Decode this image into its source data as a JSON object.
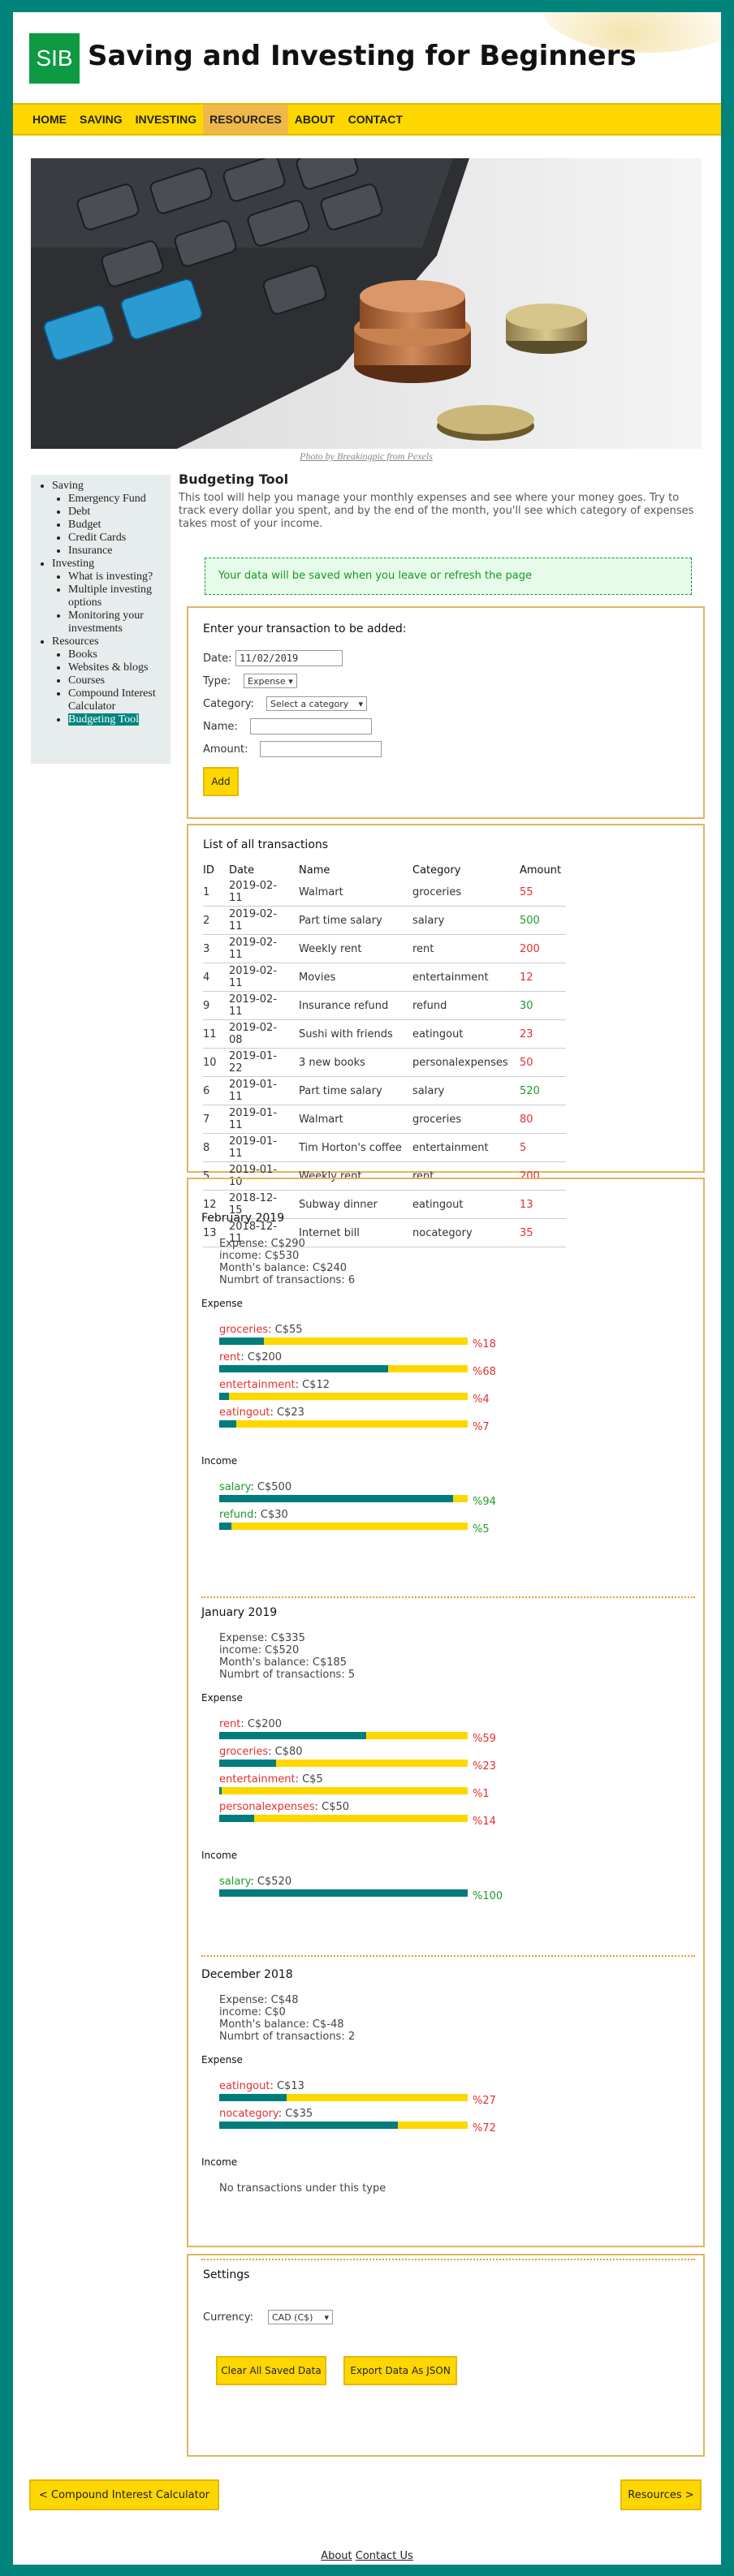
{
  "site": {
    "logo_text": "SIB",
    "title": "Saving and Investing for Beginners"
  },
  "nav": {
    "items": [
      "HOME",
      "SAVING",
      "INVESTING",
      "RESOURCES",
      "ABOUT",
      "CONTACT"
    ],
    "active": "RESOURCES"
  },
  "hero": {
    "credit": "Photo by Breakingpic from Pexels"
  },
  "sidebar": {
    "saving": "Saving",
    "saving_items": [
      "Emergency Fund",
      "Debt",
      "Budget",
      "Credit Cards",
      "Insurance"
    ],
    "investing": "Investing",
    "investing_items": [
      "What is investing?",
      "Multiple investing options",
      "Monitoring your investments"
    ],
    "resources": "Resources",
    "resources_items": [
      "Books",
      "Websites & blogs",
      "Courses",
      "Compound Interest Calculator",
      "Budgeting Tool"
    ]
  },
  "tool": {
    "title": "Budgeting Tool",
    "intro": "This tool will help you manage your monthly expenses and see where your money goes. Try to track every dollar you spent, and by the end of the month, you'll see which category of expenses takes most of your income.",
    "notice": "Your data will be saved when you leave or refresh the page"
  },
  "form": {
    "heading": "Enter your transaction to be added:",
    "date_label": "Date:",
    "date_value": "11/02/2019",
    "type_label": "Type:",
    "type_value": "Expense",
    "category_label": "Category:",
    "category_value": "Select a category",
    "name_label": "Name:",
    "amount_label": "Amount:",
    "add_button": "Add"
  },
  "list": {
    "heading": "List of all transactions",
    "columns": [
      "ID",
      "Date",
      "Name",
      "Category",
      "Amount"
    ],
    "rows": [
      {
        "id": "1",
        "date": "2019-02-11",
        "name": "Walmart",
        "category": "groceries",
        "amount": "55",
        "kind": "exp"
      },
      {
        "id": "2",
        "date": "2019-02-11",
        "name": "Part time salary",
        "category": "salary",
        "amount": "500",
        "kind": "inc"
      },
      {
        "id": "3",
        "date": "2019-02-11",
        "name": "Weekly rent",
        "category": "rent",
        "amount": "200",
        "kind": "exp"
      },
      {
        "id": "4",
        "date": "2019-02-11",
        "name": "Movies",
        "category": "entertainment",
        "amount": "12",
        "kind": "exp"
      },
      {
        "id": "9",
        "date": "2019-02-11",
        "name": "Insurance refund",
        "category": "refund",
        "amount": "30",
        "kind": "inc"
      },
      {
        "id": "11",
        "date": "2019-02-08",
        "name": "Sushi with friends",
        "category": "eatingout",
        "amount": "23",
        "kind": "exp"
      },
      {
        "id": "10",
        "date": "2019-01-22",
        "name": "3 new books",
        "category": "personalexpenses",
        "amount": "50",
        "kind": "exp"
      },
      {
        "id": "6",
        "date": "2019-01-11",
        "name": "Part time salary",
        "category": "salary",
        "amount": "520",
        "kind": "inc"
      },
      {
        "id": "7",
        "date": "2019-01-11",
        "name": "Walmart",
        "category": "groceries",
        "amount": "80",
        "kind": "exp"
      },
      {
        "id": "8",
        "date": "2019-01-11",
        "name": "Tim Horton's coffee",
        "category": "entertainment",
        "amount": "5",
        "kind": "exp"
      },
      {
        "id": "5",
        "date": "2019-01-10",
        "name": "Weekly rent",
        "category": "rent",
        "amount": "200",
        "kind": "exp"
      },
      {
        "id": "12",
        "date": "2018-12-15",
        "name": "Subway dinner",
        "category": "eatingout",
        "amount": "13",
        "kind": "exp"
      },
      {
        "id": "13",
        "date": "2018-12-11",
        "name": "Internet bill",
        "category": "nocategory",
        "amount": "35",
        "kind": "exp"
      }
    ]
  },
  "months": [
    {
      "title": "February 2019",
      "stats": [
        "Expense: C$290",
        "income: C$530",
        "Month's balance: C$240",
        "Numbrt of transactions: 6"
      ],
      "expense_label": "Expense",
      "expense": [
        {
          "cat": "groceries",
          "amount": ": C$55",
          "pct": 18,
          "pct_label": "%18"
        },
        {
          "cat": "rent",
          "amount": ": C$200",
          "pct": 68,
          "pct_label": "%68"
        },
        {
          "cat": "entertainment",
          "amount": ": C$12",
          "pct": 4,
          "pct_label": "%4"
        },
        {
          "cat": "eatingout",
          "amount": ": C$23",
          "pct": 7,
          "pct_label": "%7"
        }
      ],
      "income_label": "Income",
      "income": [
        {
          "cat": "salary",
          "amount": ": C$500",
          "pct": 94,
          "pct_label": "%94"
        },
        {
          "cat": "refund",
          "amount": ": C$30",
          "pct": 5,
          "pct_label": "%5"
        }
      ],
      "empty_income": ""
    },
    {
      "title": "January 2019",
      "stats": [
        "Expense: C$335",
        "income: C$520",
        "Month's balance: C$185",
        "Numbrt of transactions: 5"
      ],
      "expense_label": "Expense",
      "expense": [
        {
          "cat": "rent",
          "amount": ": C$200",
          "pct": 59,
          "pct_label": "%59"
        },
        {
          "cat": "groceries",
          "amount": ": C$80",
          "pct": 23,
          "pct_label": "%23"
        },
        {
          "cat": "entertainment",
          "amount": ": C$5",
          "pct": 1,
          "pct_label": "%1"
        },
        {
          "cat": "personalexpenses",
          "amount": ": C$50",
          "pct": 14,
          "pct_label": "%14"
        }
      ],
      "income_label": "Income",
      "income": [
        {
          "cat": "salary",
          "amount": ": C$520",
          "pct": 100,
          "pct_label": "%100"
        }
      ],
      "empty_income": ""
    },
    {
      "title": "December 2018",
      "stats": [
        "Expense: C$48",
        "income: C$0",
        "Month's balance: C$-48",
        "Numbrt of transactions: 2"
      ],
      "expense_label": "Expense",
      "expense": [
        {
          "cat": "eatingout",
          "amount": ": C$13",
          "pct": 27,
          "pct_label": "%27"
        },
        {
          "cat": "nocategory",
          "amount": ": C$35",
          "pct": 72,
          "pct_label": "%72"
        }
      ],
      "income_label": "Income",
      "income": [],
      "empty_income": "No transactions under this type"
    }
  ],
  "settings": {
    "heading": "Settings",
    "currency_label": "Currency:",
    "currency_value": "CAD (C$)",
    "clear_button": "Clear All Saved Data",
    "export_button": "Export Data As JSON"
  },
  "footer": {
    "prev": "< Compound Interest Calculator",
    "next": "Resources >",
    "links": [
      "About",
      "Contact Us"
    ]
  },
  "colors": {
    "brand_teal": "#00847c",
    "accent_yellow": "#ffd700",
    "logo_green": "#0d9a42",
    "expense_red": "#e03030",
    "income_green": "#1f9a2c"
  }
}
